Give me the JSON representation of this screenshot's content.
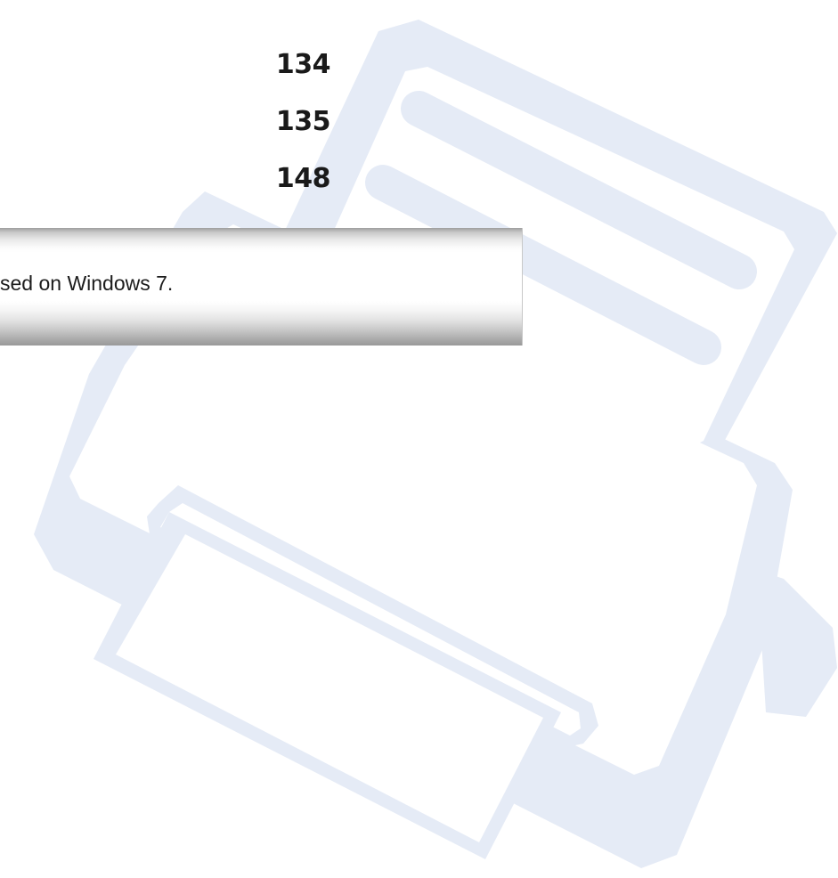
{
  "page_numbers": [
    "134",
    "135",
    "148"
  ],
  "note": {
    "text": "sed on Windows 7."
  },
  "colors": {
    "watermark": "#e5ebf6",
    "text": "#1a1a1a",
    "banner_edge": "#9e9e9e"
  },
  "icons": {
    "watermark": "printer-icon"
  }
}
